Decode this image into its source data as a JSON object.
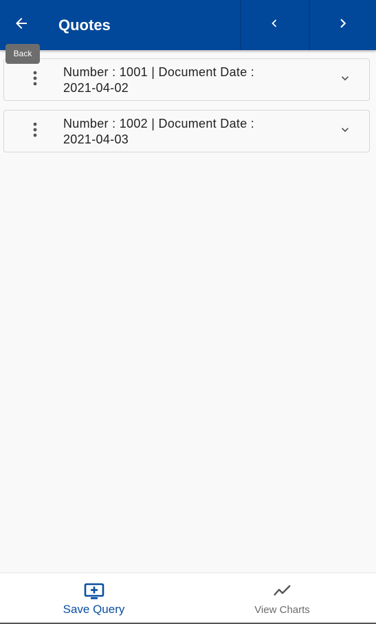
{
  "header": {
    "title": "Quotes",
    "back_icon": "arrow-left-icon",
    "prev_icon": "chevron-left-icon",
    "next_icon": "chevron-right-icon",
    "background": "#01479a"
  },
  "tooltip": {
    "text": "Back"
  },
  "records": [
    {
      "line1": "Number  : 1001 | Document Date  :",
      "line2": "2021-04-02"
    },
    {
      "line1": "Number  : 1002 | Document Date  :",
      "line2": "2021-04-03"
    }
  ],
  "bottom_bar": {
    "save_label": "Save Query",
    "save_icon": "add-to-screen-icon",
    "charts_label": "View Charts",
    "charts_icon": "trend-line-icon",
    "active_color": "#0a4ea1",
    "inactive_color": "#6b6b6b"
  }
}
